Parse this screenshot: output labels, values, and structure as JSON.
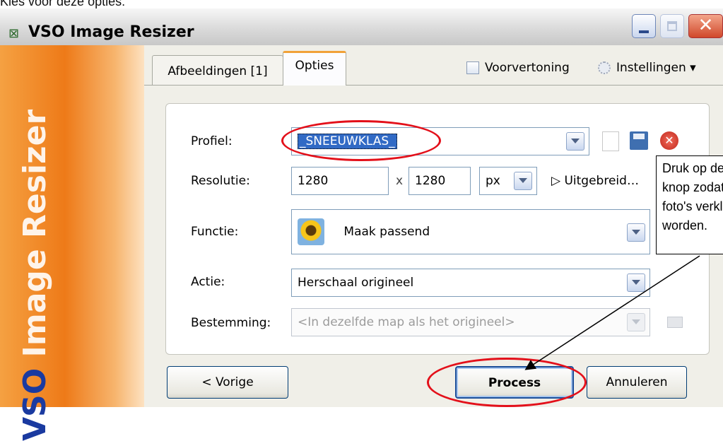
{
  "document": {
    "caption": "Kies voor deze opties:"
  },
  "window": {
    "title": "VSO Image Resizer",
    "minimize_label": "",
    "close_label": "✕"
  },
  "sidebar": {
    "brand_prefix": "VSO",
    "brand_text": " Image Resizer"
  },
  "tabs": [
    {
      "label": "Afbeeldingen [1]"
    },
    {
      "label": "Opties"
    }
  ],
  "toolbar": {
    "preview_label": "Voorvertoning",
    "settings_label": "Instellingen ▾"
  },
  "form": {
    "profile_label": "Profiel:",
    "profile_value": "_SNEEUWKLAS_",
    "resolution_label": "Resolutie:",
    "width_value": "1280",
    "x_label": "x",
    "height_value": "1280",
    "unit_value": "px",
    "advanced_label": "▷ Uitgebreid…",
    "function_label": "Functie:",
    "function_value": "Maak passend",
    "action_label": "Actie:",
    "action_value": "Herschaal origineel",
    "destination_label": "Bestemming:",
    "destination_placeholder": "<In dezelfde map als het origineel>"
  },
  "buttons": {
    "previous": "< Vorige",
    "process": "Process",
    "cancel": "Annuleren"
  },
  "annotation": {
    "lines": [
      "Druk op deze",
      "knop zodat de",
      "foto's verkleind",
      "worden."
    ]
  },
  "colors": {
    "sidebar_accent": "#ee7a18",
    "highlight_oval": "#e3101a",
    "selection": "#316ac5"
  }
}
